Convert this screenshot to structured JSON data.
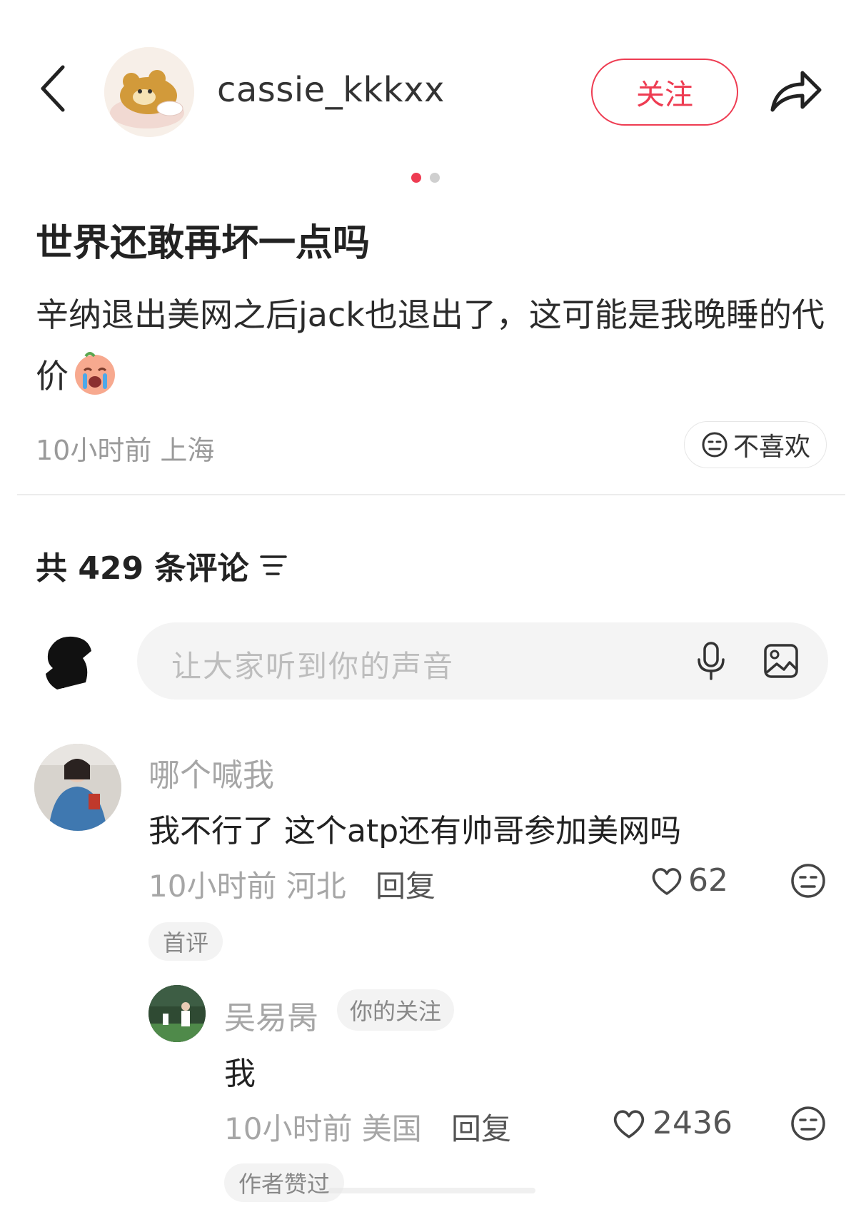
{
  "header": {
    "author_name": "cassie_kkkxx",
    "follow_label": "关注"
  },
  "carousel": {
    "pages": 2,
    "active_index": 0
  },
  "post": {
    "title": "世界还敢再坏一点吗",
    "body": "辛纳退出美网之后jack也退出了，这可能是我晚睡的代价",
    "meta": "10小时前 上海",
    "dislike_label": "不喜欢"
  },
  "comments_section": {
    "count_label": "共 429 条评论",
    "input_placeholder": "让大家听到你的声音"
  },
  "comments": [
    {
      "author": "哪个喊我",
      "text": "我不行了 这个atp还有帅哥参加美网吗",
      "meta": "10小时前 河北",
      "reply_label": "回复",
      "likes": "62",
      "badge": "首评",
      "replies": [
        {
          "author": "吴易昺",
          "author_badge": "你的关注",
          "text": "我",
          "meta": "10小时前 美国",
          "reply_label": "回复",
          "likes": "2436",
          "badge": "作者赞过"
        }
      ]
    }
  ],
  "colors": {
    "accent": "#ee3c52",
    "muted_text": "#a6a6a6",
    "input_bg": "#f4f4f4"
  },
  "icons": [
    "back-arrow-icon",
    "share-icon",
    "dislike-face-icon",
    "sort-filter-icon",
    "mic-icon",
    "image-icon",
    "heart-icon"
  ]
}
